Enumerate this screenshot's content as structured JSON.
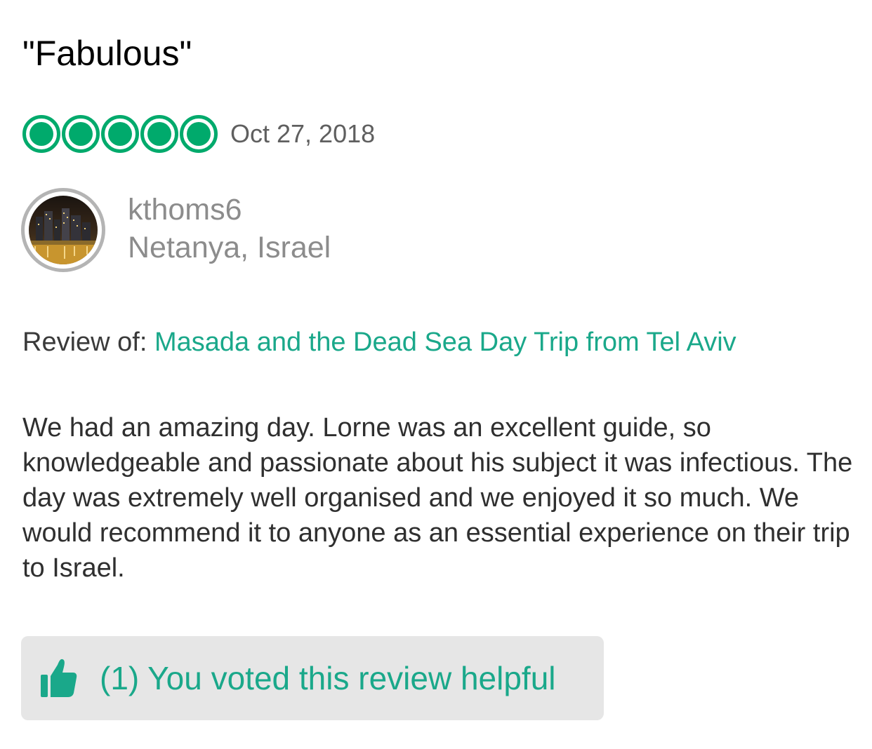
{
  "review": {
    "title": "\"Fabulous\"",
    "rating": 5,
    "rating_max": 5,
    "date": "Oct 27, 2018"
  },
  "reviewer": {
    "username": "kthoms6",
    "location": "Netanya, Israel"
  },
  "review_of": {
    "label": "Review of:",
    "link_text": "Masada and the Dead Sea Day Trip from Tel Aviv"
  },
  "body": "We had an amazing day. Lorne was an excellent guide, so knowledgeable and passionate about his subject it was infectious. The day was extremely well organised and we enjoyed it so much. We would recommend it to anyone as an essential experience on their trip to Israel.",
  "helpful": {
    "label": "(1) You voted this review helpful",
    "icon": "thumbs-up-icon"
  },
  "colors": {
    "accent": "#00aa6c",
    "link": "#1aa88a",
    "muted_text": "#8c8c8c",
    "button_bg": "#e6e6e6"
  }
}
